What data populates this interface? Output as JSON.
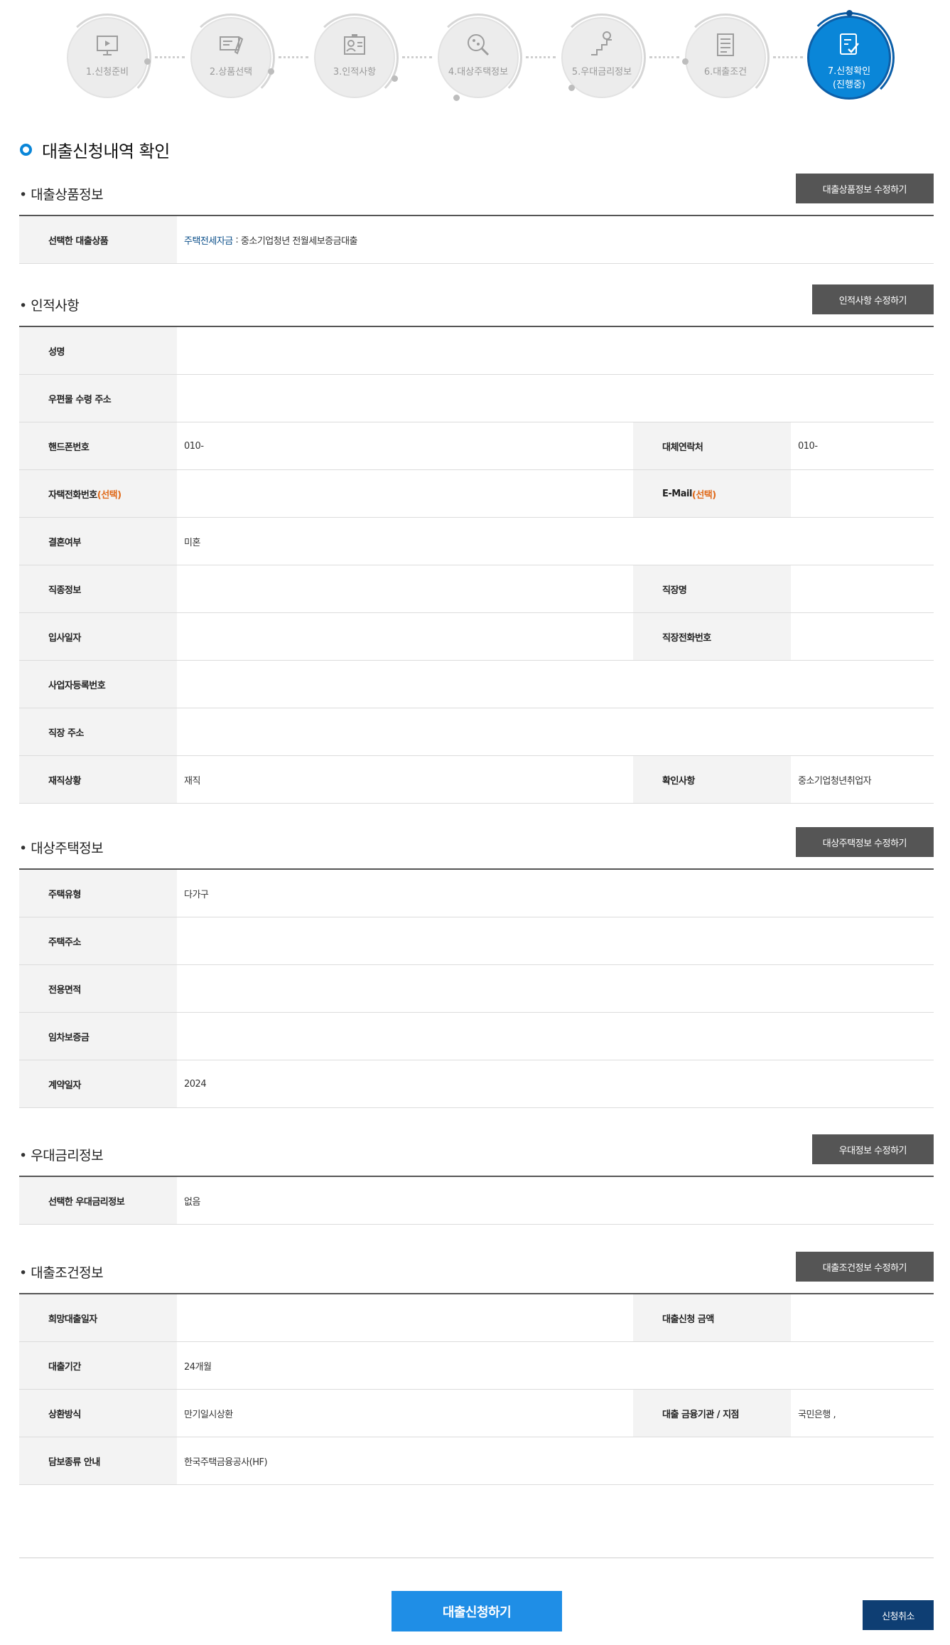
{
  "steps": [
    {
      "label": "1.신청준비",
      "icon": "monitor-icon"
    },
    {
      "label": "2.상품선택",
      "icon": "card-select-icon"
    },
    {
      "label": "3.인적사항",
      "icon": "id-card-icon"
    },
    {
      "label": "4.대상주택정보",
      "icon": "magnifier-icon"
    },
    {
      "label": "5.우대금리정보",
      "icon": "stairs-coin-icon"
    },
    {
      "label": "6.대출조건",
      "icon": "document-icon"
    },
    {
      "label": "7.신청확인",
      "label2": "(진행중)",
      "icon": "checklist-icon",
      "active": true
    }
  ],
  "page_title": "대출신청내역 확인",
  "loan_product": {
    "title": "대출상품정보",
    "edit_label": "대출상품정보 수정하기",
    "selected_label": "선택한 대출상품",
    "product_type": "주택전세자금",
    "product_sep": " : ",
    "product_name": "중소기업청년 전월세보증금대출"
  },
  "personal": {
    "title": "인적사항",
    "edit_label": "인적사항 수정하기",
    "name_label": "성명",
    "name_value": "",
    "mail_addr_label": "우편물 수령 주소",
    "mail_addr_value": "",
    "mobile_label": "핸드폰번호",
    "mobile_value": "010-",
    "alt_contact_label": "대체연락처",
    "alt_contact_value": "010-",
    "home_phone_label": "자택전화번호",
    "home_phone_optional": "(선택)",
    "home_phone_value": "",
    "email_label": "E-Mail",
    "email_optional": "(선택)",
    "email_value": "",
    "marital_label": "결혼여부",
    "marital_value": "미혼",
    "job_type_label": "직종정보",
    "job_type_value": "",
    "company_label": "직장명",
    "company_value": "",
    "join_date_label": "입사일자",
    "join_date_value": "",
    "work_phone_label": "직장전화번호",
    "work_phone_value": "",
    "biz_no_label": "사업자등록번호",
    "biz_no_value": "",
    "work_addr_label": "직장 주소",
    "work_addr_value": "",
    "employment_label": "재직상황",
    "employment_value": "재직",
    "confirm_label": "확인사항",
    "confirm_value": "중소기업청년취업자"
  },
  "house": {
    "title": "대상주택정보",
    "edit_label": "대상주택정보 수정하기",
    "type_label": "주택유형",
    "type_value": "다가구",
    "addr_label": "주택주소",
    "addr_value": "",
    "area_label": "전용면적",
    "area_value": "",
    "deposit_label": "임차보증금",
    "deposit_value": "",
    "contract_label": "계약일자",
    "contract_value": "2024"
  },
  "preferential": {
    "title": "우대금리정보",
    "edit_label": "우대정보 수정하기",
    "selected_label": "선택한 우대금리정보",
    "selected_value": "없음"
  },
  "loan_terms": {
    "title": "대출조건정보",
    "edit_label": "대출조건정보 수정하기",
    "desired_date_label": "희망대출일자",
    "desired_date_value": "",
    "amount_label": "대출신청 금액",
    "amount_value": "",
    "period_label": "대출기간",
    "period_value": "24개월",
    "repay_label": "상환방식",
    "repay_value": "만기일시상환",
    "bank_label": "대출 금융기관 / 지점",
    "bank_value": "국민은행 ,",
    "collateral_label": "담보종류 안내",
    "collateral_value": "한국주택금융공사(HF)"
  },
  "footer": {
    "submit_label": "대출신청하기",
    "cancel_label": "신청취소"
  },
  "colors": {
    "accent": "#0a86d8",
    "edit_button": "#555555",
    "submit_button": "#1f8ee6",
    "cancel_button": "#0e3e73",
    "optional_text": "#e06a1a"
  }
}
